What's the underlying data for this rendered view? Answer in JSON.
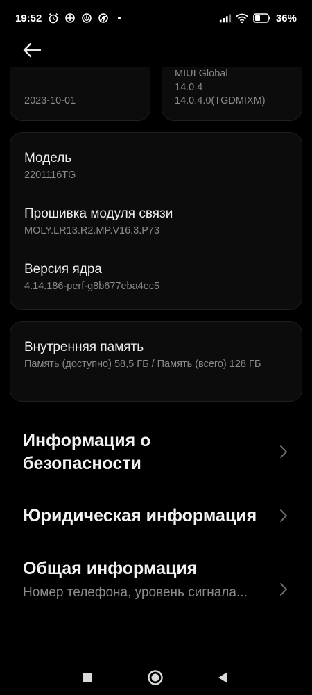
{
  "status_bar": {
    "time": "19:52",
    "battery_percent": "36%",
    "icons": [
      "alarm-icon",
      "location-icon",
      "power-icon",
      "chrome-icon",
      "notification-dot-icon",
      "signal-icon",
      "wifi-icon",
      "battery-icon"
    ]
  },
  "header": {
    "back_icon": "arrow-left-icon"
  },
  "top_cards": {
    "left_value": "2023-10-01",
    "right_line1": "MIUI Global",
    "right_line2": "14.0.4",
    "right_line3": "14.0.4.0(TGDMIXM)"
  },
  "device_card": {
    "model_label": "Модель",
    "model_value": "2201116TG",
    "baseband_label": "Прошивка модуля связи",
    "baseband_value": "MOLY.LR13.R2.MP.V16.3.P73",
    "kernel_label": "Версия ядра",
    "kernel_value": "4.14.186-perf-g8b677eba4ec5"
  },
  "storage_card": {
    "label": "Внутренняя память",
    "value": "Память (доступно)  58,5 ГБ / Память (всего)  128 ГБ"
  },
  "list": {
    "security_title": "Информация о безопасности",
    "legal_title": "Юридическая информация",
    "general_title": "Общая информация",
    "general_sub": "Номер телефона, уровень сигнала..."
  },
  "nav_bar": {
    "icons": [
      "recents-square-icon",
      "home-circle-icon",
      "back-triangle-icon"
    ]
  },
  "colors": {
    "background": "#000000",
    "card": "#0c0c0c",
    "primary_text": "#ededed",
    "secondary_text": "#8a8a8a"
  }
}
